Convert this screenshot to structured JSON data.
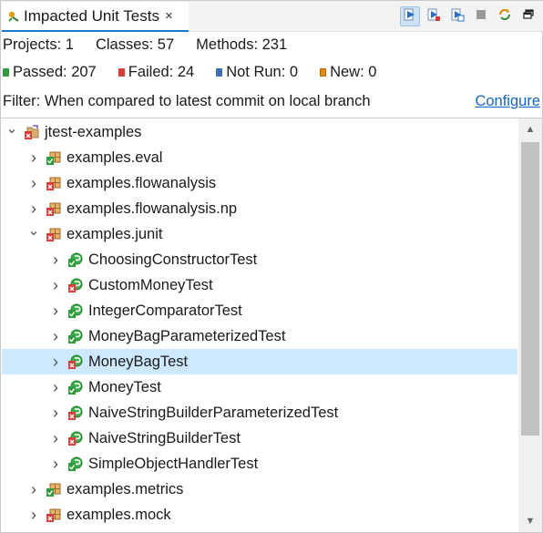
{
  "tab": {
    "title": "Impacted Unit Tests",
    "close_glyph": "×"
  },
  "toolbar": [
    {
      "name": "run-tests-button",
      "icon": "run-icon",
      "active": true
    },
    {
      "name": "run-failed-button",
      "icon": "run-failed-icon",
      "active": false
    },
    {
      "name": "run-selected-button",
      "icon": "run-selected-icon",
      "active": false
    },
    {
      "name": "stop-button",
      "icon": "stop-icon",
      "active": false
    },
    {
      "name": "refresh-button",
      "icon": "refresh-icon",
      "active": false
    },
    {
      "name": "restore-button",
      "icon": "restore-icon",
      "active": false
    }
  ],
  "stats": {
    "projects": "Projects: 1",
    "classes": "Classes: 57",
    "methods": "Methods: 231",
    "passed": "Passed: 207",
    "failed": "Failed: 24",
    "not_run": "Not Run: 0",
    "new": "New: 0"
  },
  "filter": {
    "text": "Filter: When compared to latest commit on local branch",
    "configure": "Configure"
  },
  "tree": [
    {
      "label": "jtest-examples",
      "level": 0,
      "expanded": true,
      "kind": "project",
      "state": "fail"
    },
    {
      "label": "examples.eval",
      "level": 1,
      "expanded": false,
      "kind": "package",
      "state": "pass"
    },
    {
      "label": "examples.flowanalysis",
      "level": 1,
      "expanded": false,
      "kind": "package",
      "state": "fail"
    },
    {
      "label": "examples.flowanalysis.np",
      "level": 1,
      "expanded": false,
      "kind": "package",
      "state": "fail"
    },
    {
      "label": "examples.junit",
      "level": 1,
      "expanded": true,
      "kind": "package",
      "state": "fail"
    },
    {
      "label": "ChoosingConstructorTest",
      "level": 2,
      "expanded": false,
      "kind": "class",
      "state": "pass"
    },
    {
      "label": "CustomMoneyTest",
      "level": 2,
      "expanded": false,
      "kind": "class",
      "state": "fail"
    },
    {
      "label": "IntegerComparatorTest",
      "level": 2,
      "expanded": false,
      "kind": "class",
      "state": "pass"
    },
    {
      "label": "MoneyBagParameterizedTest",
      "level": 2,
      "expanded": false,
      "kind": "class",
      "state": "pass"
    },
    {
      "label": "MoneyBagTest",
      "level": 2,
      "expanded": false,
      "kind": "class",
      "state": "fail",
      "selected": true
    },
    {
      "label": "MoneyTest",
      "level": 2,
      "expanded": false,
      "kind": "class",
      "state": "pass"
    },
    {
      "label": "NaiveStringBuilderParameterizedTest",
      "level": 2,
      "expanded": false,
      "kind": "class",
      "state": "fail"
    },
    {
      "label": "NaiveStringBuilderTest",
      "level": 2,
      "expanded": false,
      "kind": "class",
      "state": "fail"
    },
    {
      "label": "SimpleObjectHandlerTest",
      "level": 2,
      "expanded": false,
      "kind": "class",
      "state": "pass"
    },
    {
      "label": "examples.metrics",
      "level": 1,
      "expanded": false,
      "kind": "package",
      "state": "pass"
    },
    {
      "label": "examples.mock",
      "level": 1,
      "expanded": false,
      "kind": "package",
      "state": "fail"
    }
  ],
  "colors": {
    "accent": "#1c79c9",
    "selection": "#cde8ff",
    "pass": "#2f9a3e",
    "fail": "#d93b3b",
    "link": "#1565c0"
  }
}
